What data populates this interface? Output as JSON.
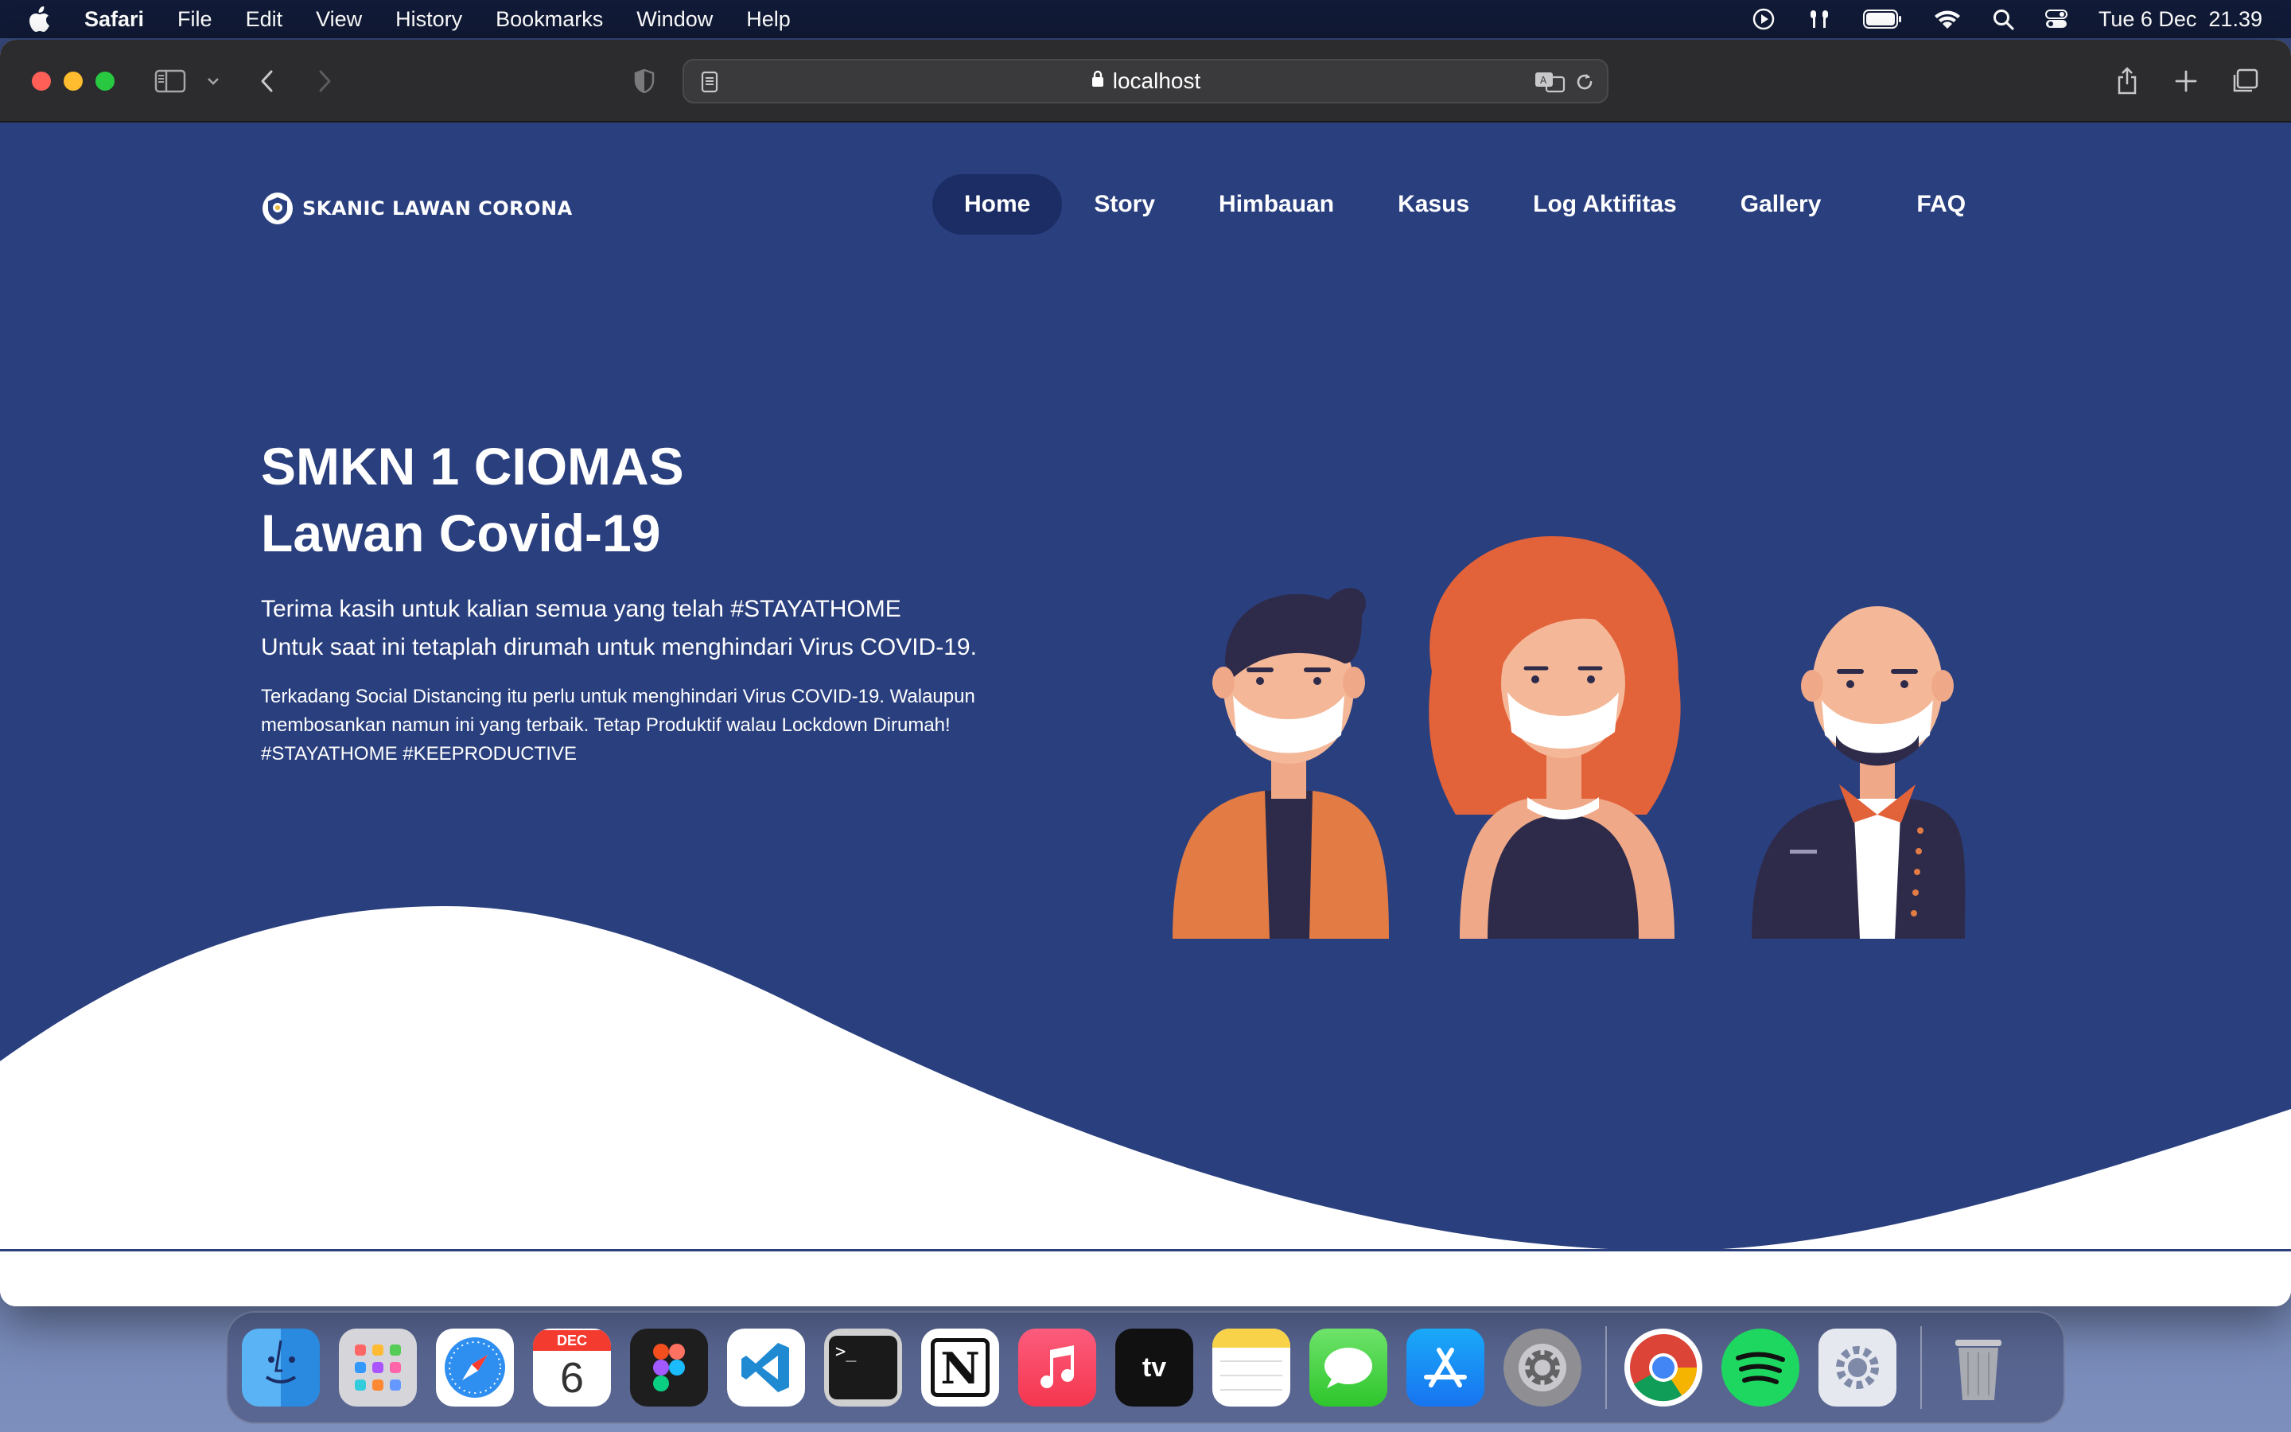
{
  "menubar": {
    "app": "Safari",
    "items": [
      "File",
      "Edit",
      "View",
      "History",
      "Bookmarks",
      "Window",
      "Help"
    ],
    "clock": "Tue 6 Dec  21.39",
    "status_icons": [
      "play-circle-icon",
      "airpods-icon",
      "battery-icon",
      "wifi-icon",
      "spotlight-search-icon",
      "control-center-icon"
    ]
  },
  "browser": {
    "url": "localhost",
    "toolbar_icons": [
      "sidebar-icon",
      "chevron-down-icon",
      "back-arrow-icon",
      "forward-arrow-icon",
      "shield-icon",
      "reader-icon",
      "translate-icon",
      "reload-icon",
      "share-icon",
      "new-tab-icon",
      "tab-overview-icon"
    ]
  },
  "site": {
    "brand": "SKANIC LAWAN CORONA",
    "nav": [
      {
        "label": "Home",
        "active": true
      },
      {
        "label": "Story",
        "active": false
      },
      {
        "label": "Himbauan",
        "active": false
      },
      {
        "label": "Kasus",
        "active": false
      },
      {
        "label": "Log Aktifitas",
        "active": false
      },
      {
        "label": "Gallery",
        "active": false
      },
      {
        "label": "FAQ",
        "active": false
      }
    ],
    "hero": {
      "title": "SMKN 1 CIOMAS\nLawan Covid-19",
      "subtitle_line1": "Terima kasih untuk kalian semua yang telah #STAYATHOME",
      "subtitle_line2": "Untuk saat ini tetaplah dirumah untuk menghindari Virus COVID-19.",
      "body": "Terkadang Social Distancing itu perlu untuk menghindari Virus COVID-19. Walaupun membosankan namun ini yang terbaik. Tetap Produktif walau Lockdown Dirumah! #STAYATHOME #KEEPRODUCTIVE"
    },
    "colors": {
      "hero_bg": "#2a3f7e",
      "nav_active": "#1b2d64",
      "accent_orange": "#e8713e"
    }
  },
  "calendar_month": "DEC",
  "calendar_day": "6",
  "dock": {
    "apps": [
      {
        "name": "finder-icon",
        "running": true
      },
      {
        "name": "launchpad-icon",
        "running": false
      },
      {
        "name": "safari-icon",
        "running": true
      },
      {
        "name": "calendar-icon",
        "running": false
      },
      {
        "name": "figma-icon",
        "running": false
      },
      {
        "name": "vscode-icon",
        "running": true
      },
      {
        "name": "terminal-icon",
        "running": false
      },
      {
        "name": "notion-icon",
        "running": false
      },
      {
        "name": "music-icon",
        "running": false
      },
      {
        "name": "apple-tv-icon",
        "running": false
      },
      {
        "name": "notes-icon",
        "running": false
      },
      {
        "name": "messages-icon",
        "running": false
      },
      {
        "name": "app-store-icon",
        "running": false
      },
      {
        "name": "system-preferences-icon",
        "running": false
      },
      {
        "name": "chrome-icon",
        "running": true
      },
      {
        "name": "spotify-icon",
        "running": true
      },
      {
        "name": "utility-gear-icon",
        "running": true
      },
      {
        "name": "trash-icon",
        "running": false
      }
    ]
  }
}
